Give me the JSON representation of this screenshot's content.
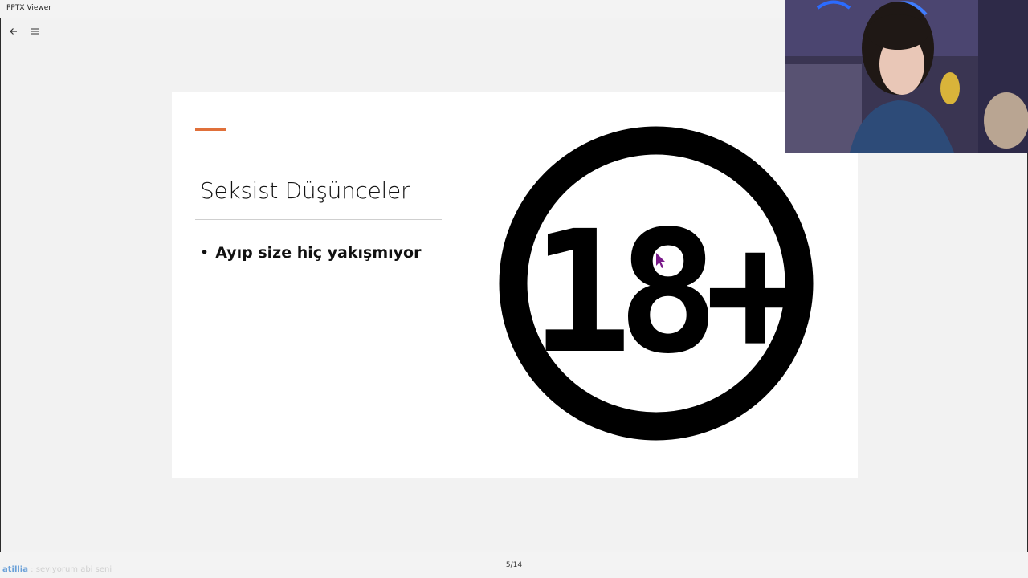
{
  "window": {
    "title": "PPTX Viewer"
  },
  "toolbar": {
    "back_icon": "arrow-left-icon",
    "menu_icon": "hamburger-menu-icon"
  },
  "slide": {
    "accent_color": "#e0703a",
    "title": "Seksist Düşünceler",
    "bullets": [
      "Ayıp size hiç yakışmıyor"
    ],
    "graphic": {
      "text": "18+",
      "icon": "age-restriction-18-plus-icon"
    }
  },
  "pagination": {
    "current": 5,
    "total": 14,
    "label": "5/14"
  },
  "chat": {
    "user": "atillia",
    "separator": " : ",
    "message": "seviyorum abi seni"
  },
  "webcam": {
    "label": "webcam-overlay"
  }
}
